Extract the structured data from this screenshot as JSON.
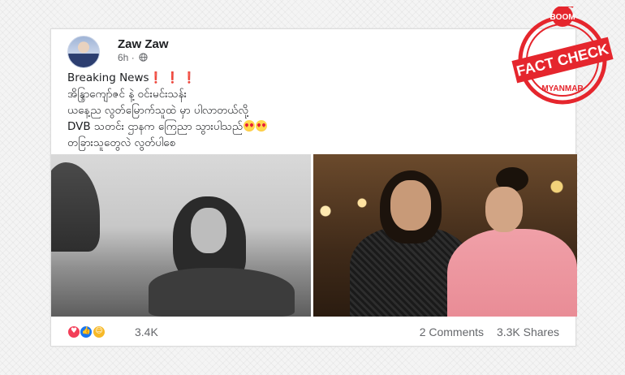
{
  "post": {
    "author": "Zaw Zaw",
    "time": "6h",
    "privacy_icon": "globe-icon",
    "breaking": "Breaking News",
    "exclamations": "❗ ❗ ❗",
    "lines": [
      "အိန္ဒြာကျော်ဇင် နဲ့ ဝင်းမင်းသန်း",
      "ယနေ့ည လွတ်မြောက်သူထဲ မှာ ပါလာတယ်လို့",
      "DVB သတင်း ဌာနက ကြေညာ သွားပါသည်",
      "တခြားသူတွေလဲ လွတ်ပါစေ"
    ],
    "emojis": [
      "heart-eyes-emoji",
      "heart-eyes-emoji"
    ],
    "reactions": [
      "love",
      "like",
      "care"
    ],
    "reaction_count": "3.4K",
    "comments": "2 Comments",
    "shares": "3.3K Shares"
  },
  "badge": {
    "brand": "BOOM",
    "title": "FACT CHECK",
    "subtitle": "MYANMAR",
    "color": "#e5262d"
  }
}
